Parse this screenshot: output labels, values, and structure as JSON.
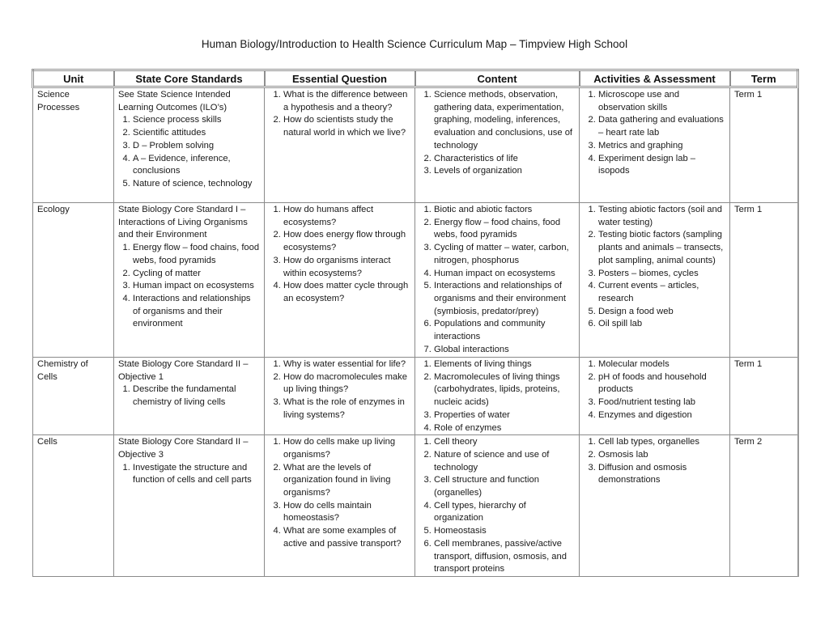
{
  "document": {
    "title": "Human Biology/Introduction to Health Science Curriculum Map – Timpview High School"
  },
  "table": {
    "headers": {
      "unit": "Unit",
      "standards": "State Core Standards",
      "question": "Essential Question",
      "content": "Content",
      "activities": "Activities & Assessment",
      "term": "Term"
    },
    "rows": [
      {
        "unit": "Science Processes",
        "standards_intro": "See State Science Intended Learning Outcomes (ILO’s)",
        "standards": [
          "Science process skills",
          "Scientific attitudes",
          "D – Problem solving",
          "A – Evidence, inference, conclusions",
          "Nature of science, technology"
        ],
        "questions": [
          "What is the difference between a hypothesis and a theory?",
          "How do scientists study the natural world in which we live?"
        ],
        "content": [
          "Science methods, observation, gathering data, experimentation, graphing, modeling, inferences, evaluation and conclusions, use of technology",
          "Characteristics of life",
          "Levels of organization"
        ],
        "activities": [
          "Microscope use and observation skills",
          "Data gathering and evaluations – heart rate lab",
          "Metrics and graphing",
          "Experiment design lab – isopods"
        ],
        "term": "Term 1"
      },
      {
        "unit": "Ecology",
        "standards_intro": "State Biology Core Standard I – Interactions of Living Organisms and their Environment",
        "standards": [
          "Energy flow – food chains, food webs, food pyramids",
          "Cycling of matter",
          "Human impact on ecosystems",
          "Interactions and relationships of organisms and their environment"
        ],
        "questions": [
          "How do humans affect ecosystems?",
          "How does energy flow through ecosystems?",
          "How do organisms interact within ecosystems?",
          "How does matter cycle through an ecosystem?"
        ],
        "content": [
          "Biotic and abiotic factors",
          "Energy flow – food chains, food webs, food pyramids",
          "Cycling of matter – water, carbon, nitrogen, phosphorus",
          "Human impact on ecosystems",
          "Interactions and relationships of organisms and their environment (symbiosis, predator/prey)",
          "Populations and community interactions",
          "Global interactions"
        ],
        "activities": [
          "Testing abiotic factors (soil and water testing)",
          "Testing biotic factors (sampling plants and animals – transects, plot sampling, animal counts)",
          "Posters – biomes, cycles",
          "Current events – articles, research",
          "Design a food web",
          "Oil spill lab"
        ],
        "term": "Term 1"
      },
      {
        "unit": "Chemistry of Cells",
        "standards_intro": "State Biology Core Standard II – Objective 1",
        "standards": [
          "Describe the fundamental chemistry of living cells"
        ],
        "questions": [
          "Why is water essential for life?",
          "How do macromolecules make up living things?",
          "What is the role of enzymes in living systems?"
        ],
        "content": [
          "Elements of living things",
          "Macromolecules of living things (carbohydrates, lipids, proteins, nucleic acids)",
          "Properties of water",
          "Role of enzymes"
        ],
        "activities": [
          "Molecular models",
          "pH of foods and household products",
          "Food/nutrient testing lab",
          "Enzymes and digestion"
        ],
        "term": "Term 1"
      },
      {
        "unit": "Cells",
        "standards_intro": "State Biology Core Standard II – Objective 3",
        "standards": [
          "Investigate the structure and function of cells and cell parts"
        ],
        "questions": [
          "How do cells make up living organisms?",
          "What are the levels of organization found in living organisms?",
          "How do cells maintain homeostasis?",
          "What are some examples of active and passive transport?"
        ],
        "content": [
          "Cell theory",
          "Nature of science and use of technology",
          "Cell structure and function (organelles)",
          "Cell types, hierarchy of organization",
          "Homeostasis",
          "Cell membranes, passive/active transport, diffusion, osmosis, and transport proteins"
        ],
        "activities": [
          "Cell lab  types, organelles",
          "Osmosis lab",
          "Diffusion and osmosis demonstrations"
        ],
        "term": "Term 2"
      }
    ]
  }
}
